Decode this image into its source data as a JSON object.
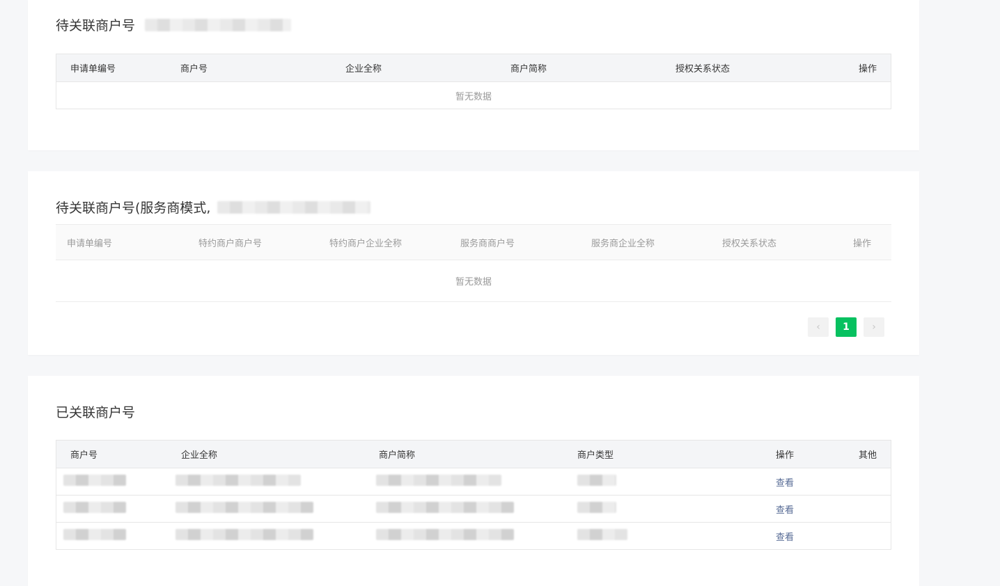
{
  "section1": {
    "title": "待关联商户号",
    "columns": [
      "申请单编号",
      "商户号",
      "企业全称",
      "商户简称",
      "授权关系状态",
      "操作"
    ],
    "empty_text": "暂无数据"
  },
  "section2": {
    "title": "待关联商户号(服务商模式,",
    "columns": [
      "申请单编号",
      "特约商户商户号",
      "特约商户企业全称",
      "服务商商户号",
      "服务商企业全称",
      "授权关系状态",
      "操作"
    ],
    "empty_text": "暂无数据",
    "pagination": {
      "prev_icon": "chevron-left-icon",
      "current_page": "1",
      "next_icon": "chevron-right-icon"
    }
  },
  "section3": {
    "title": "已关联商户号",
    "columns": [
      "商户号",
      "企业全称",
      "商户简称",
      "商户类型",
      "操作",
      "其他"
    ],
    "rows": [
      {
        "action": "查看"
      },
      {
        "action": "查看"
      },
      {
        "action": "查看"
      }
    ]
  },
  "colors": {
    "accent": "#07c160",
    "link": "#576b95",
    "background": "#f6f7f9"
  }
}
